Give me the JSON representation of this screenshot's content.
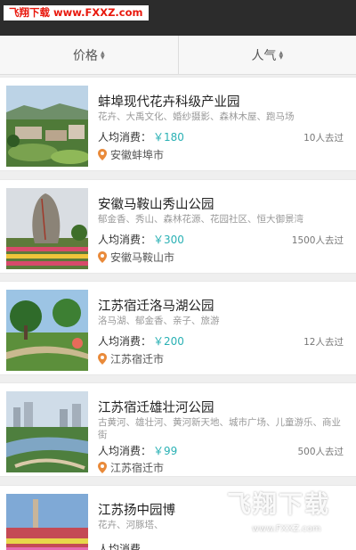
{
  "watermark_top": "飞翔下载 www.FXXZ.com",
  "sort_tabs": [
    {
      "label": "价格"
    },
    {
      "label": "人气"
    }
  ],
  "cards": [
    {
      "title": "蚌埠现代花卉科级产业园",
      "tags": "花卉、大禹文化、婚纱摄影、森林木屋、跑马场",
      "price_label": "人均消费：",
      "price": "￥180",
      "visits": "10人去过",
      "location": "安徽蚌埠市"
    },
    {
      "title": "安徽马鞍山秀山公园",
      "tags": "郁金香、秀山、森林花源、花园社区、恒大御景湾",
      "price_label": "人均消费：",
      "price": "￥300",
      "visits": "1500人去过",
      "location": "安徽马鞍山市"
    },
    {
      "title": "江苏宿迁洛马湖公园",
      "tags": "洛马湖、郁金香、亲子、旅游",
      "price_label": "人均消费：",
      "price": "￥200",
      "visits": "12人去过",
      "location": "江苏宿迁市"
    },
    {
      "title": "江苏宿迁雄壮河公园",
      "tags": "古黄河、雄壮河、黄河新天地、城市广场、儿童游乐、商业街",
      "price_label": "人均消费：",
      "price": "￥99",
      "visits": "500人去过",
      "location": "江苏宿迁市"
    },
    {
      "title": "江苏扬中园博",
      "tags": "花卉、河豚塔、",
      "price_label": "人均消费",
      "price": "",
      "visits": "",
      "location": ""
    }
  ],
  "watermark_bottom": {
    "text": "飞翔下载",
    "url": "www.FXXZ.com"
  },
  "colors": {
    "price": "#2ab1b4",
    "pin": "#e98a3a",
    "topbar": "#2c2c2c"
  }
}
